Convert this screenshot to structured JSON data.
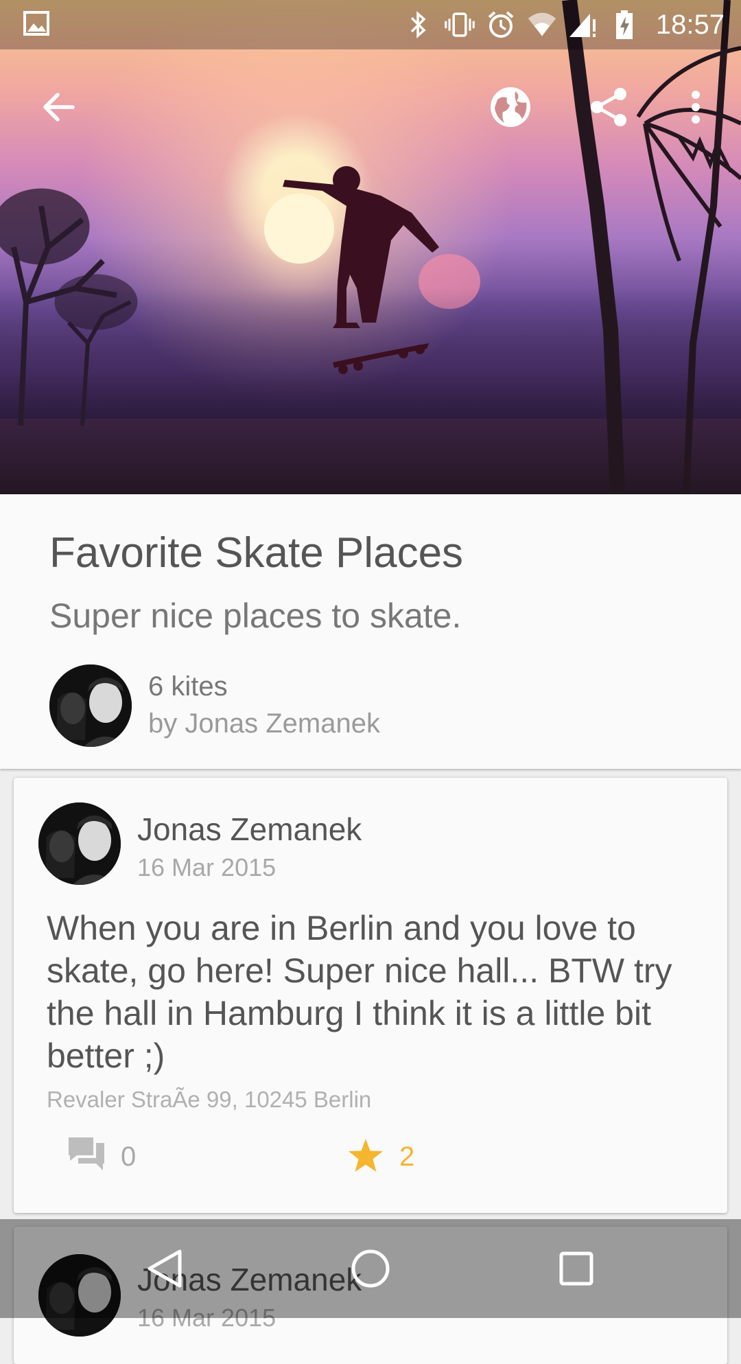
{
  "status_bar": {
    "time": "18:57",
    "icons": [
      "image-notification-icon",
      "bluetooth-icon",
      "vibrate-icon",
      "alarm-icon",
      "wifi-icon",
      "cell-signal-icon",
      "battery-charging-icon"
    ]
  },
  "toolbar": {
    "back_icon": "arrow-back-icon",
    "globe_icon": "globe-icon",
    "share_icon": "share-icon",
    "more_icon": "more-vert-icon"
  },
  "collection": {
    "title": "Favorite Skate Places",
    "subtitle": "Super nice places to skate.",
    "count": "6 kites",
    "author": "by Jonas Zemanek"
  },
  "posts": [
    {
      "author": "Jonas Zemanek",
      "date": "16 Mar 2015",
      "text": "When you are in Berlin and you love to skate, go here! Super nice hall... BTW try the hall in Hamburg I think it is a little bit better ;)",
      "address": "Revaler StraÃe 99, 10245 Berlin",
      "comments": "0",
      "stars": "2"
    },
    {
      "author": "Jonas Zemanek",
      "date": "16 Mar 2015"
    }
  ],
  "colors": {
    "star": "#f5b52e",
    "text_primary": "#555555",
    "text_secondary": "#a8a8a8"
  },
  "nav_bar": {
    "icons": [
      "nav-back-icon",
      "nav-home-icon",
      "nav-recents-icon"
    ]
  }
}
